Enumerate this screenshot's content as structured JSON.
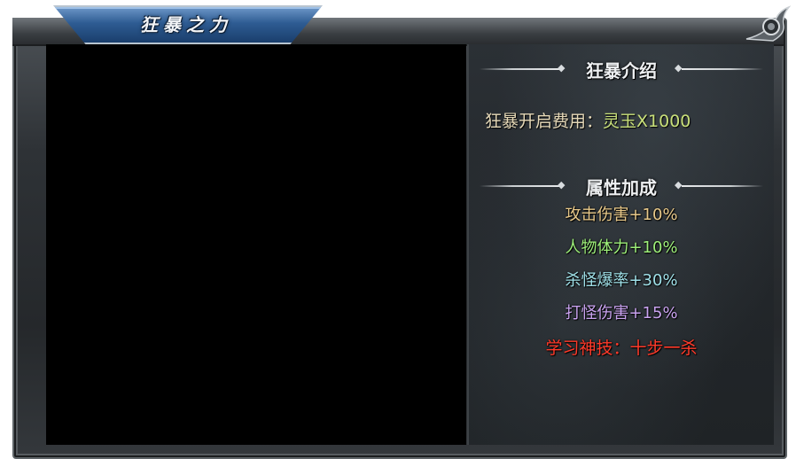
{
  "window": {
    "title": "狂暴之力"
  },
  "intro_section": {
    "title": "狂暴介绍",
    "cost_label": "狂暴开启费用：",
    "cost_value": "灵玉X1000"
  },
  "bonus_section": {
    "title": "属性加成",
    "attributes": [
      {
        "text": "攻击伤害+10%",
        "color": "#e8c98a"
      },
      {
        "text": "人物体力+10%",
        "color": "#9ef07a"
      },
      {
        "text": "杀怪爆率+30%",
        "color": "#9fe0e8"
      },
      {
        "text": "打怪伤害+15%",
        "color": "#c9a3f0"
      }
    ],
    "skill": {
      "text": "学习神技：十步一杀",
      "color": "#ff3a2a"
    }
  },
  "colors": {
    "title_tab": "#2e5c93",
    "frame": "#2e3236",
    "video_bg": "#000000"
  }
}
